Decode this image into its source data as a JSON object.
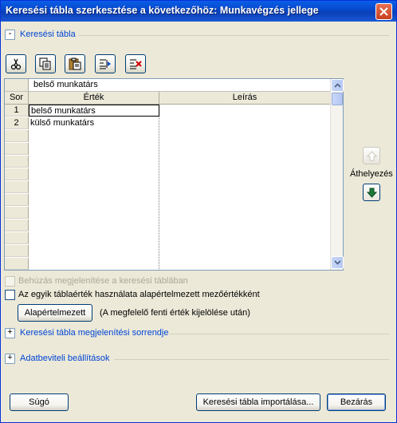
{
  "window": {
    "title": "Keresési tábla szerkesztése a következőhöz: Munkavégzés jellege"
  },
  "lookup_section": {
    "toggle": "-",
    "label": "Keresési tábla"
  },
  "toolbar": {
    "buttons": [
      "scissors-icon",
      "copy-icon",
      "paste-icon",
      "insert-row-icon",
      "delete-row-icon"
    ]
  },
  "grid": {
    "edit_value": "belső munkatárs",
    "columns": {
      "row": "Sor",
      "value": "Érték",
      "description": "Leírás"
    },
    "rows": [
      {
        "num": "1",
        "value": "belső munkatárs",
        "description": ""
      },
      {
        "num": "2",
        "value": "külső munkatárs",
        "description": ""
      }
    ]
  },
  "move": {
    "label": "Áthelyezés",
    "up_icon": "arrow-up-icon",
    "down_icon": "arrow-down-icon"
  },
  "options": {
    "show_indent": "Behúzás megjelenítése a keresési táblában",
    "use_default": "Az egyik táblaérték használata alapértelmezett mezőértékként",
    "default_button": "Alapértelmezett",
    "default_hint": "(A megfelelő fenti érték kijelölése után)"
  },
  "display_order_section": {
    "toggle": "+",
    "label": "Keresési tábla megjelenítési sorrendje"
  },
  "data_entry_section": {
    "toggle": "+",
    "label": "Adatbeviteli beállítások"
  },
  "footer": {
    "help": "Súgó",
    "import": "Keresési tábla importálása...",
    "close": "Bezárás"
  },
  "colors": {
    "title_bar": "#0a5ee8",
    "dialog_bg": "#ece9d8",
    "link_blue": "#0046d5",
    "close_red": "#c7401f"
  }
}
